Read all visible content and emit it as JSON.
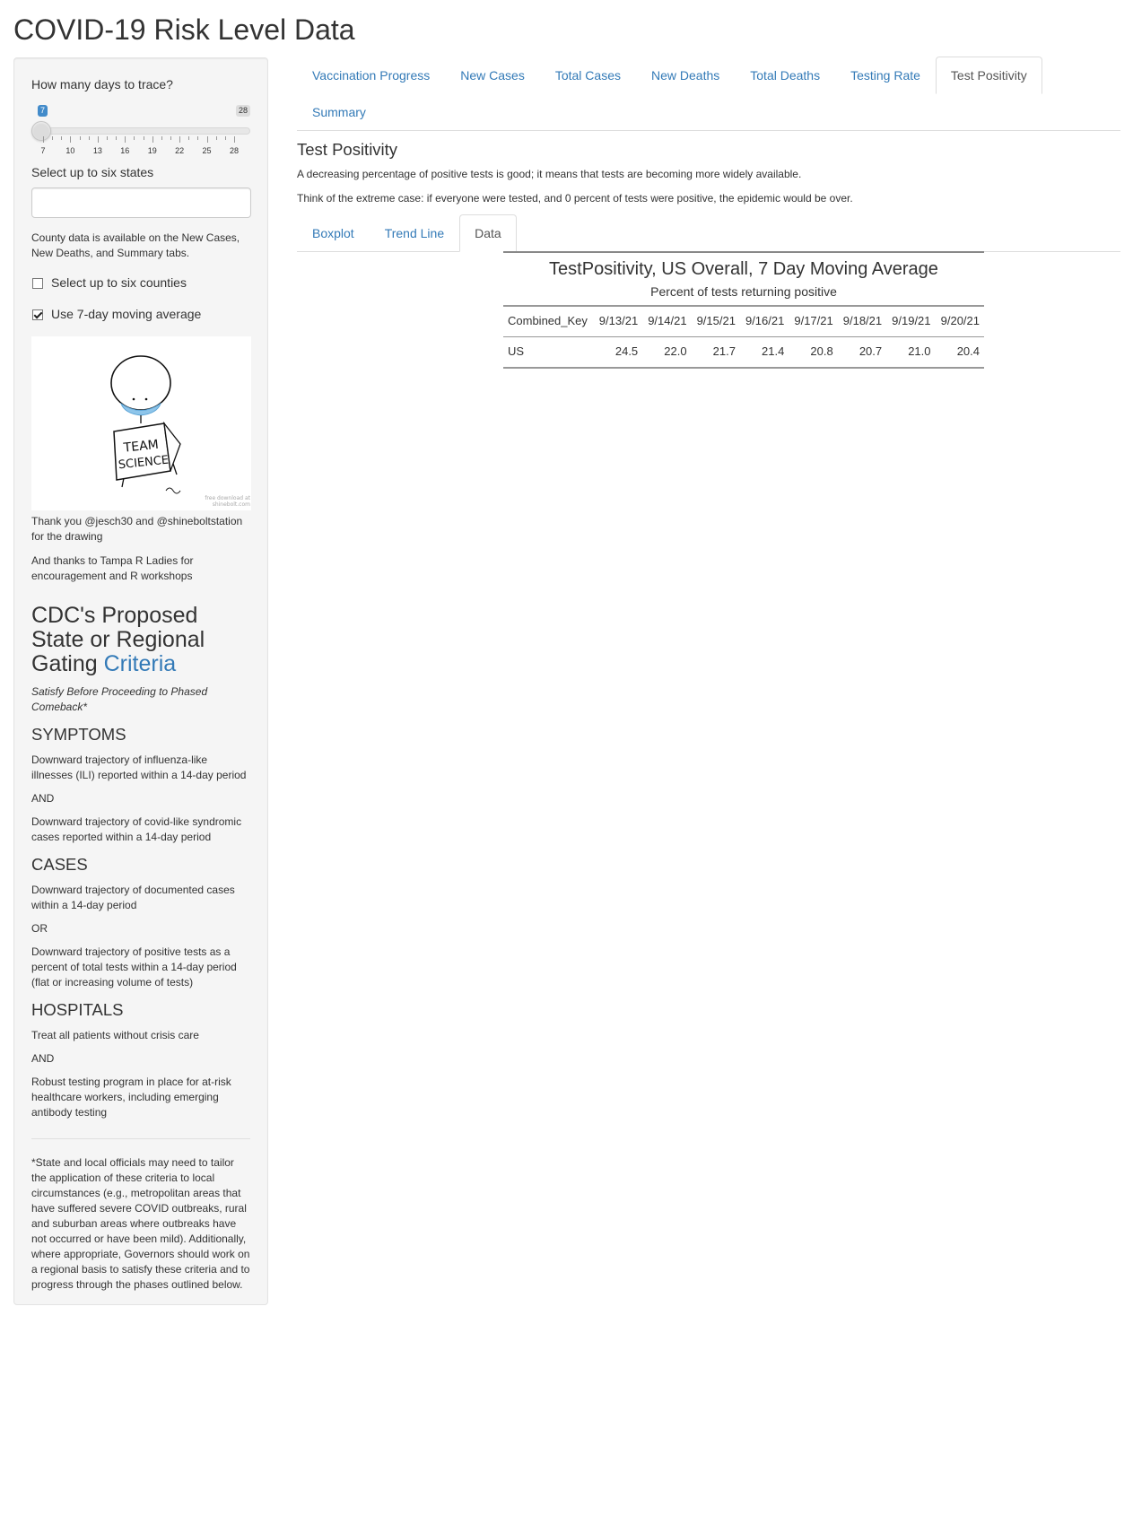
{
  "app": {
    "title": "COVID-19 Risk Level Data"
  },
  "sidebar": {
    "days_label": "How many days to trace?",
    "slider": {
      "value": "7",
      "max_label": "28",
      "min": 7,
      "max": 28,
      "tick_labels": [
        "7",
        "10",
        "13",
        "16",
        "19",
        "22",
        "25",
        "28"
      ]
    },
    "states_label": "Select up to six states",
    "states_input_value": "",
    "county_note": "County data is available on the New Cases, New Deaths, and Summary tabs.",
    "checkbox_counties": {
      "label": "Select up to six counties",
      "checked": false
    },
    "checkbox_moving_avg": {
      "label": "Use 7-day moving average",
      "checked": true
    },
    "drawing": {
      "sign_text_line1": "TEAM",
      "sign_text_line2": "SCIENCE",
      "credit_line1": "free download at",
      "credit_line2": "shinebolt.com"
    },
    "thanks1": "Thank you @jesch30 and @shineboltstation for the drawing",
    "thanks2": "And thanks to Tampa R Ladies for encouragement and R workshops",
    "cdc_heading_text": "CDC's Proposed State or Regional Gating",
    "cdc_heading_link": "Criteria",
    "cdc_subtitle": "Satisfy Before Proceeding to Phased Comeback*",
    "symptoms_heading": "SYMPTOMS",
    "symptoms_p1": "Downward trajectory of influenza-like illnesses (ILI) reported within a 14-day period",
    "symptoms_and": "AND",
    "symptoms_p2": "Downward trajectory of covid-like syndromic cases reported within a 14-day period",
    "cases_heading": "CASES",
    "cases_p1": "Downward trajectory of documented cases within a 14-day period",
    "cases_or": "OR",
    "cases_p2": "Downward trajectory of positive tests as a percent of total tests within a 14-day period (flat or increasing volume of tests)",
    "hospitals_heading": "HOSPITALS",
    "hospitals_p1": "Treat all patients without crisis care",
    "hospitals_and": "AND",
    "hospitals_p2": "Robust testing program in place for at-risk healthcare workers, including emerging antibody testing",
    "footnote": "*State and local officials may need to tailor the application of these criteria to local circumstances (e.g., metropolitan areas that have suffered severe COVID outbreaks, rural and suburban areas where outbreaks have not occurred or have been mild). Additionally, where appropriate, Governors should work on a regional basis to satisfy these criteria and to progress through the phases outlined below."
  },
  "main": {
    "tabs": [
      {
        "label": "Vaccination Progress"
      },
      {
        "label": "New Cases"
      },
      {
        "label": "Total Cases"
      },
      {
        "label": "New Deaths"
      },
      {
        "label": "Total Deaths"
      },
      {
        "label": "Testing Rate"
      },
      {
        "label": "Test Positivity",
        "active": true
      },
      {
        "label": "Summary"
      }
    ],
    "panel": {
      "title": "Test Positivity",
      "text1": "A decreasing percentage of positive tests is good; it means that tests are becoming more widely available.",
      "text2": "Think of the extreme case: if everyone were tested, and 0 percent of tests were positive, the epidemic would be over."
    },
    "subtabs": [
      {
        "label": "Boxplot"
      },
      {
        "label": "Trend Line"
      },
      {
        "label": "Data",
        "active": true
      }
    ],
    "table": {
      "title": "TestPositivity, US Overall, 7 Day Moving Average",
      "subtitle": "Percent of tests returning positive",
      "columns": [
        "Combined_Key",
        "9/13/21",
        "9/14/21",
        "9/15/21",
        "9/16/21",
        "9/17/21",
        "9/18/21",
        "9/19/21",
        "9/20/21"
      ],
      "rows": [
        [
          "US",
          "24.5",
          "22.0",
          "21.7",
          "21.4",
          "20.8",
          "20.7",
          "21.0",
          "20.4"
        ]
      ]
    }
  }
}
